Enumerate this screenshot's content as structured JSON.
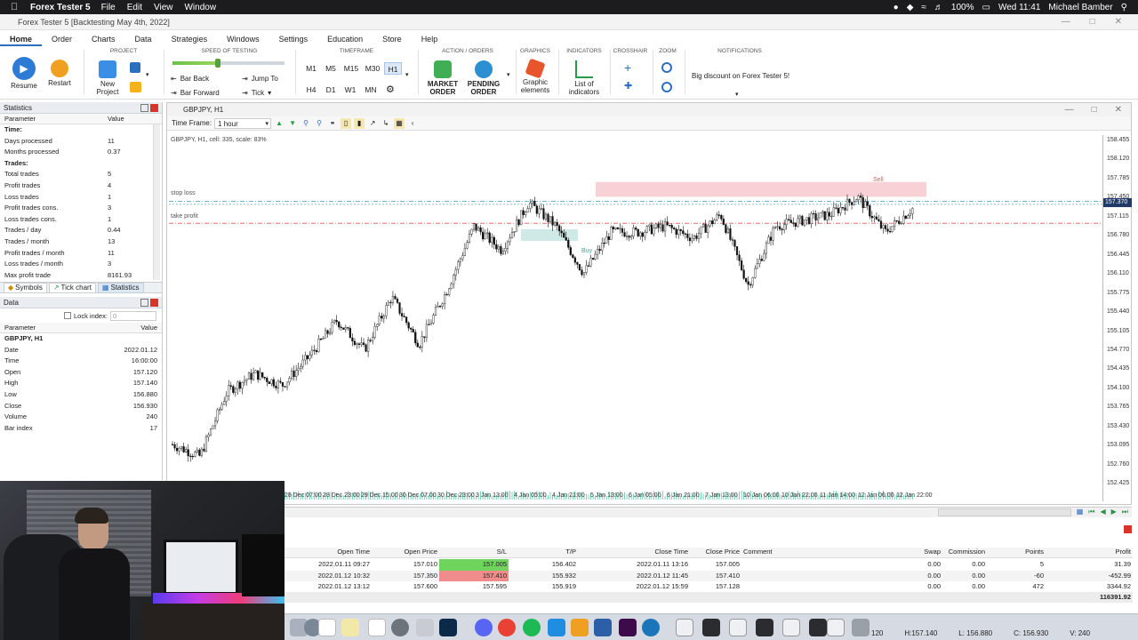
{
  "menubar": {
    "app_name": "Forex Tester 5",
    "items": [
      "File",
      "Edit",
      "View",
      "Window"
    ],
    "battery": "100%",
    "datetime": "Wed 11:41",
    "user": "Michael Bamber"
  },
  "window": {
    "title": "Forex Tester 5 [Backtesting May 4th, 2022]"
  },
  "ribbon_tabs": [
    "Home",
    "Order",
    "Charts",
    "Data",
    "Strategies",
    "Windows",
    "Settings",
    "Education",
    "Store",
    "Help"
  ],
  "ribbon": {
    "resume": "Resume",
    "restart": "Restart",
    "project_label": "PROJECT",
    "new_project": "New Project",
    "speed_label": "SPEED OF TESTING",
    "bar_back": "Bar Back",
    "bar_forward": "Bar Forward",
    "jump_to": "Jump To",
    "tick": "Tick",
    "timeframe_label": "TIMEFRAME",
    "timeframes_row1": [
      "M1",
      "M5",
      "M15",
      "M30",
      "H1"
    ],
    "timeframes_row2": [
      "H4",
      "D1",
      "W1",
      "MN"
    ],
    "selected_timeframe": "H1",
    "action_label": "ACTION / ORDERS",
    "market_order": "MARKET ORDER",
    "pending_order": "PENDING ORDER",
    "graphics_label": "GRAPHICS",
    "graphic_elements": "Graphic elements",
    "indicators_label": "INDICATORS",
    "list_of_indicators": "List of indicators",
    "crosshair_label": "CROSSHAIR",
    "zoom_label": "ZOOM",
    "notifications_label": "NOTIFICATIONS",
    "notification_text": "Big discount on Forex Tester 5!"
  },
  "statistics": {
    "title": "Statistics",
    "col_param": "Parameter",
    "col_value": "Value",
    "rows": [
      {
        "k": "Time:",
        "v": "",
        "sec": true
      },
      {
        "k": "Days processed",
        "v": "11"
      },
      {
        "k": "Months processed",
        "v": "0.37"
      },
      {
        "k": "Trades:",
        "v": "",
        "sec": true
      },
      {
        "k": "Total trades",
        "v": "5"
      },
      {
        "k": "Profit trades",
        "v": "4"
      },
      {
        "k": "Loss trades",
        "v": "1"
      },
      {
        "k": "Profit trades cons.",
        "v": "3"
      },
      {
        "k": "Loss trades cons.",
        "v": "1"
      },
      {
        "k": "Trades / day",
        "v": "0.44"
      },
      {
        "k": "Trades / month",
        "v": "13"
      },
      {
        "k": "Profit trades / month",
        "v": "11"
      },
      {
        "k": "Loss trades / month",
        "v": "3"
      },
      {
        "k": "Max profit trade",
        "v": "8161.93"
      }
    ]
  },
  "panel_tabs": [
    "Symbols",
    "Tick chart",
    "Statistics"
  ],
  "data_panel": {
    "title": "Data",
    "lock_index": "Lock index:",
    "lock_value": "0",
    "col_param": "Parameter",
    "col_value": "Value",
    "symbol": "GBPJPY, H1",
    "rows": [
      {
        "k": "Date",
        "v": "2022.01.12"
      },
      {
        "k": "Time",
        "v": "16:00:00"
      },
      {
        "k": "Open",
        "v": "157.120"
      },
      {
        "k": "High",
        "v": "157.140"
      },
      {
        "k": "Low",
        "v": "156.880"
      },
      {
        "k": "Close",
        "v": "156.930"
      },
      {
        "k": "Volume",
        "v": "240"
      },
      {
        "k": "Bar index",
        "v": "17"
      }
    ]
  },
  "chart": {
    "window_title": "GBPJPY, H1",
    "timeframe_label": "Time Frame:",
    "timeframe_value": "1 hour",
    "info": "GBPJPY, H1, cell: 335, scale: 83%",
    "stop_loss": "stop loss",
    "take_profit": "take profit",
    "sell": "Sell",
    "buy": "Buy",
    "current_price": "157.370",
    "y_labels": [
      "158.455",
      "158.120",
      "157.785",
      "157.450",
      "157.115",
      "156.780",
      "156.445",
      "156.110",
      "155.775",
      "155.440",
      "155.105",
      "154.770",
      "154.435",
      "154.100",
      "153.765",
      "153.430",
      "153.095",
      "152.760",
      "152.425"
    ],
    "x_labels": [
      "28 Dec 07:00",
      "28 Dec 23:00",
      "29 Dec 15:00",
      "30 Dec 07:00",
      "30 Dec 23:00",
      "3 Jan 13:00",
      "4 Jan 05:00",
      "4 Jan 21:00",
      "5 Jan 13:00",
      "6 Jan 05:00",
      "6 Jan 21:00",
      "7 Jan 13:00",
      "10 Jan 06:00",
      "10 Jan 22:00",
      "11 Jan 14:00",
      "12 Jan 06:00",
      "12 Jan 22:00"
    ]
  },
  "chart_data": {
    "type": "candlestick",
    "symbol": "GBPJPY",
    "timeframe": "H1",
    "ylim": [
      152.425,
      158.455
    ],
    "x": [
      "28 Dec 07:00",
      "28 Dec 23:00",
      "29 Dec 15:00",
      "30 Dec 07:00",
      "30 Dec 23:00",
      "3 Jan 13:00",
      "4 Jan 05:00",
      "4 Jan 21:00",
      "5 Jan 13:00",
      "6 Jan 05:00",
      "6 Jan 21:00",
      "7 Jan 13:00",
      "10 Jan 06:00",
      "10 Jan 22:00",
      "11 Jan 14:00",
      "12 Jan 06:00",
      "12 Jan 22:00"
    ],
    "close_path": [
      153.3,
      153.1,
      154.2,
      154.5,
      154.3,
      154.8,
      155.4,
      154.9,
      155.8,
      155.0,
      155.9,
      157.0,
      156.6,
      157.4,
      157.0,
      156.2,
      156.9,
      156.9,
      157.0,
      156.8,
      157.2,
      156.0,
      157.0,
      157.1,
      157.2,
      157.5,
      156.9,
      157.3
    ]
  },
  "orders": {
    "headers": [
      "Open Time",
      "Open Price",
      "S/L",
      "T/P",
      "Close Time",
      "Close Price",
      "Comment",
      "Swap",
      "Commission",
      "Points",
      "Profit"
    ],
    "rows": [
      {
        "open_time": "2022.01.11 09:27",
        "open_price": "157.010",
        "sl": "157.005",
        "tp": "156.402",
        "close_time": "2022.01.11 13:16",
        "close_price": "157.005",
        "comment": "",
        "swap": "0.00",
        "commission": "0.00",
        "points": "5",
        "profit": "31.39",
        "sl_color": "#6fd45c"
      },
      {
        "open_time": "2022.01.12 10:32",
        "open_price": "157.350",
        "sl": "157.410",
        "tp": "155.932",
        "close_time": "2022.01.12 11:45",
        "close_price": "157.410",
        "comment": "",
        "swap": "0.00",
        "commission": "0.00",
        "points": "-60",
        "profit": "-452.99",
        "sl_color": "#f08c8c"
      },
      {
        "open_time": "2022.01.12 13:12",
        "open_price": "157.600",
        "sl": "157.595",
        "tp": "155.919",
        "close_time": "2022.01.12 15:59",
        "close_price": "157.128",
        "comment": "",
        "swap": "0.00",
        "commission": "0.00",
        "points": "472",
        "profit": "3344.92",
        "sl_color": ""
      }
    ],
    "total": "116391.92"
  },
  "status": {
    "a": "120",
    "h": "H:157.140",
    "l": "L: 156.880",
    "c": "C: 156.930",
    "v": "V: 240"
  },
  "colors": {
    "accent": "#2c6fbf",
    "sell_zone": "#f5c6cc",
    "buy_zone": "#cfe9e6"
  }
}
